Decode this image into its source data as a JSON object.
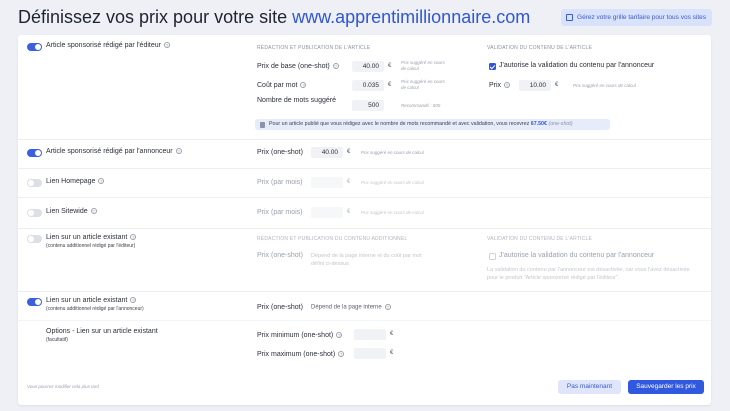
{
  "header": {
    "title": "Définissez vos prix pour votre site",
    "site": "www.apprentimillionnaire.com",
    "grid_button": "Gérez votre grille tarifaire pour tous vos sites"
  },
  "rows": {
    "editor": {
      "toggle_on": true,
      "label": "Article sponsorisé rédigé par l'éditeur",
      "section_left": "RÉDACTION ET PUBLICATION DE L'ARTICLE",
      "section_right": "VALIDATION DU CONTENU DE L'ARTICLE",
      "base_price_label": "Prix de base (one-shot)",
      "base_price_value": "40.00",
      "base_price_hint": "Prix suggéré en cours de calcul",
      "per_word_label": "Coût par mot",
      "per_word_value": "0.035",
      "per_word_hint": "Prix suggéré en cours de calcul",
      "words_label": "Nombre de mots suggéré",
      "words_value": "500",
      "words_hint": "Recommandé : 500",
      "validation_check_label": "J'autorise la validation du contenu par l'annonceur",
      "validation_checked": true,
      "validation_price_label": "Prix",
      "validation_price_value": "10.00",
      "validation_price_hint": "Prix suggéré en cours de calcul",
      "banner_text": "Pour un article publié que vous rédigez avec le nombre de mots recommandé et avec validation, vous recevrez ",
      "banner_amount": "67.50€",
      "banner_suffix": "(one-shot)"
    },
    "advertiser": {
      "toggle_on": true,
      "label": "Article sponsorisé rédigé par l'annonceur",
      "price_label": "Prix (one-shot)",
      "price_value": "40.00",
      "price_hint": "Prix suggéré en cours de calcul"
    },
    "homepage": {
      "toggle_on": false,
      "label": "Lien Homepage",
      "price_label": "Prix (par mois)",
      "price_hint": "Prix suggéré en cours de calcul"
    },
    "sitewide": {
      "toggle_on": false,
      "label": "Lien Sitewide",
      "price_label": "Prix (par mois)",
      "price_hint": "Prix suggéré en cours de calcul"
    },
    "existing_editor": {
      "toggle_on": false,
      "label": "Lien sur un article existant",
      "sublabel": "(contenu additionnel rédigé par l'éditeur)",
      "section_left": "RÉDACTION ET PUBLICATION DU CONTENU ADDITIONNEL",
      "section_right": "VALIDATION DU CONTENU DE L'ARTICLE",
      "price_label": "Prix (one-shot)",
      "price_desc": "Dépend de la page interne et du coût par mot défini ci-dessus",
      "validation_check_label": "J'autorise la validation du contenu par l'annonceur",
      "validation_note": "La validation du contenu par l'annonceur est désactivée, car vous l'avez désactivée pour le produit \"Article sponsorisé rédigé par l'éditeur\"."
    },
    "existing_advertiser": {
      "toggle_on": true,
      "label": "Lien sur un article existant",
      "sublabel": "(contenu additionnel rédigé par l'annonceur)",
      "price_label": "Prix (one-shot)",
      "price_desc": "Dépend de la page interne"
    },
    "options": {
      "label": "Options - Lien sur un article existant",
      "sublabel": "(facultatif)",
      "min_label": "Prix minimum (one-shot)",
      "max_label": "Prix maximum (one-shot)"
    }
  },
  "footer": {
    "note": "Vous pourrez modifier cela plus tard",
    "later_button": "Pas maintenant",
    "save_button": "Sauvegarder les prix"
  },
  "colors": {
    "accent": "#3159e0",
    "link": "#2f56d6",
    "background": "#eef0f5"
  }
}
